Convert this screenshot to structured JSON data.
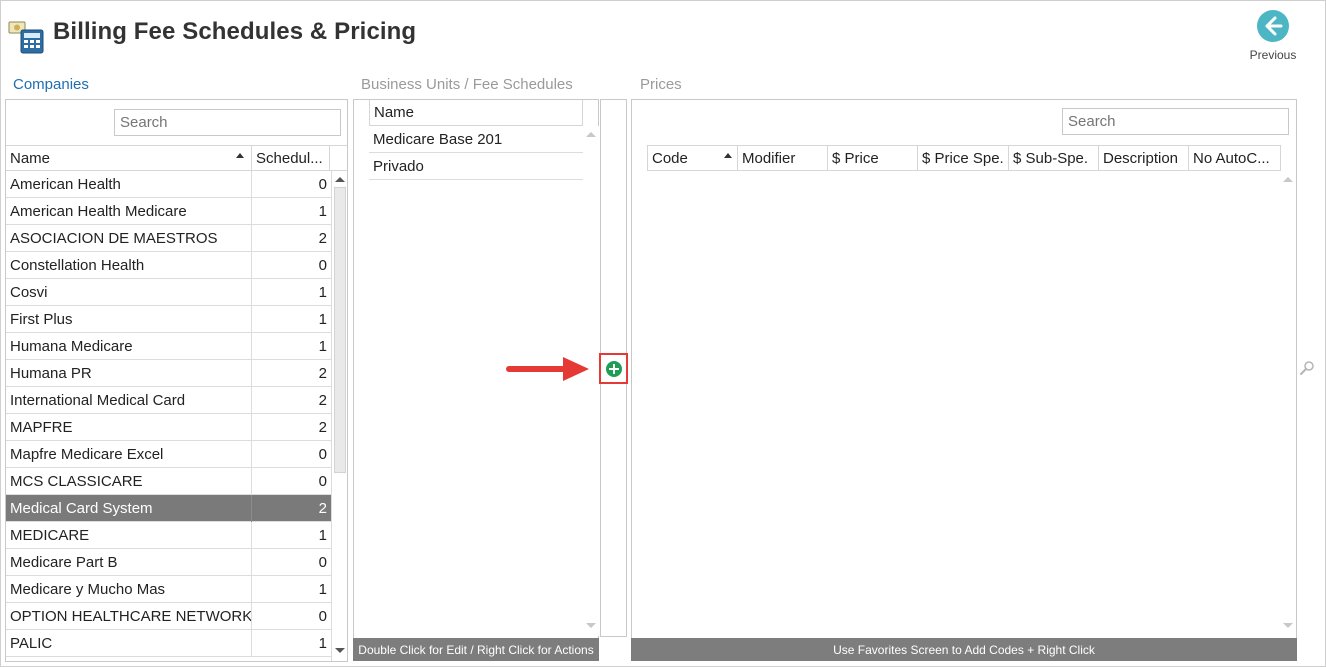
{
  "header": {
    "title": "Billing Fee Schedules & Pricing",
    "previous_label": "Previous",
    "app_icon": "calculator-money-icon",
    "previous_icon": "arrow-left-circle-icon"
  },
  "sections": {
    "companies": "Companies",
    "business_units": "Business Units / Fee Schedules",
    "prices": "Prices"
  },
  "companies": {
    "search_placeholder": "Search",
    "columns": [
      "Name",
      "Schedul..."
    ],
    "rows": [
      {
        "name": "American Health",
        "count": "0"
      },
      {
        "name": "American Health Medicare",
        "count": "1"
      },
      {
        "name": "ASOCIACION DE MAESTROS",
        "count": "2"
      },
      {
        "name": "Constellation Health",
        "count": "0"
      },
      {
        "name": "Cosvi",
        "count": "1"
      },
      {
        "name": "First Plus",
        "count": "1"
      },
      {
        "name": "Humana Medicare",
        "count": "1"
      },
      {
        "name": "Humana PR",
        "count": "2"
      },
      {
        "name": "International Medical Card",
        "count": "2"
      },
      {
        "name": "MAPFRE",
        "count": "2"
      },
      {
        "name": "Mapfre Medicare Excel",
        "count": "0"
      },
      {
        "name": "MCS CLASSICARE",
        "count": "0"
      },
      {
        "name": "Medical Card System",
        "count": "2",
        "selected": true
      },
      {
        "name": "MEDICARE",
        "count": "1"
      },
      {
        "name": "Medicare Part B",
        "count": "0"
      },
      {
        "name": "Medicare y Mucho Mas",
        "count": "1"
      },
      {
        "name": "OPTION HEALTHCARE NETWORK",
        "count": "0"
      },
      {
        "name": "PALIC",
        "count": "1"
      }
    ]
  },
  "business_units": {
    "column": "Name",
    "rows": [
      "Medicare Base 201",
      "Privado"
    ],
    "footer": "Double Click for Edit / Right Click for Actions"
  },
  "prices": {
    "search_placeholder": "Search",
    "columns": [
      "Code",
      "Modifier",
      "$ Price",
      "$ Price Spe.",
      "$ Sub-Spe.",
      "Description",
      "No AutoC..."
    ],
    "footer": "Use Favorites Screen to Add Codes + Right Click"
  },
  "colors": {
    "selected_row": "#7a7a7a",
    "link_blue": "#1f6fb2",
    "add_green": "#1e9e55",
    "highlight_red": "#e53935",
    "previous_teal": "#4db6c4"
  }
}
